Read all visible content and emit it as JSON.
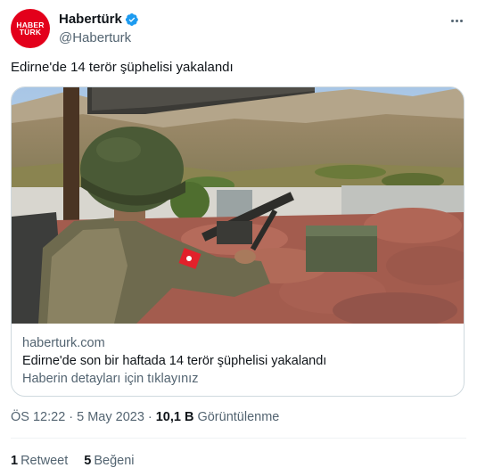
{
  "author": {
    "logo_line1": "HABER",
    "logo_line2": "TÜRK",
    "display_name": "Habertürk",
    "handle": "@Haberturk",
    "verified": true,
    "brand_color": "#e3001b"
  },
  "tweet": {
    "text": "Edirne'de 14 terör şüphelisi yakalandı"
  },
  "card": {
    "image_icon": "soldier-photo",
    "domain": "haberturk.com",
    "title": "Edirne'de son bir haftada 14 terör şüphelisi yakalandı",
    "description": "Haberin detayları için tıklayınız"
  },
  "meta": {
    "time": "ÖS 12:22",
    "separator": "·",
    "date": "5 May 2023",
    "views_count": "10,1 B",
    "views_label": "Görüntülenme"
  },
  "stats": {
    "retweets_count": "1",
    "retweets_label": "Retweet",
    "likes_count": "5",
    "likes_label": "Beğeni"
  },
  "colors": {
    "text": "#0f1419",
    "secondary": "#536471",
    "verified": "#1d9bf0",
    "border": "#cfd9de"
  }
}
